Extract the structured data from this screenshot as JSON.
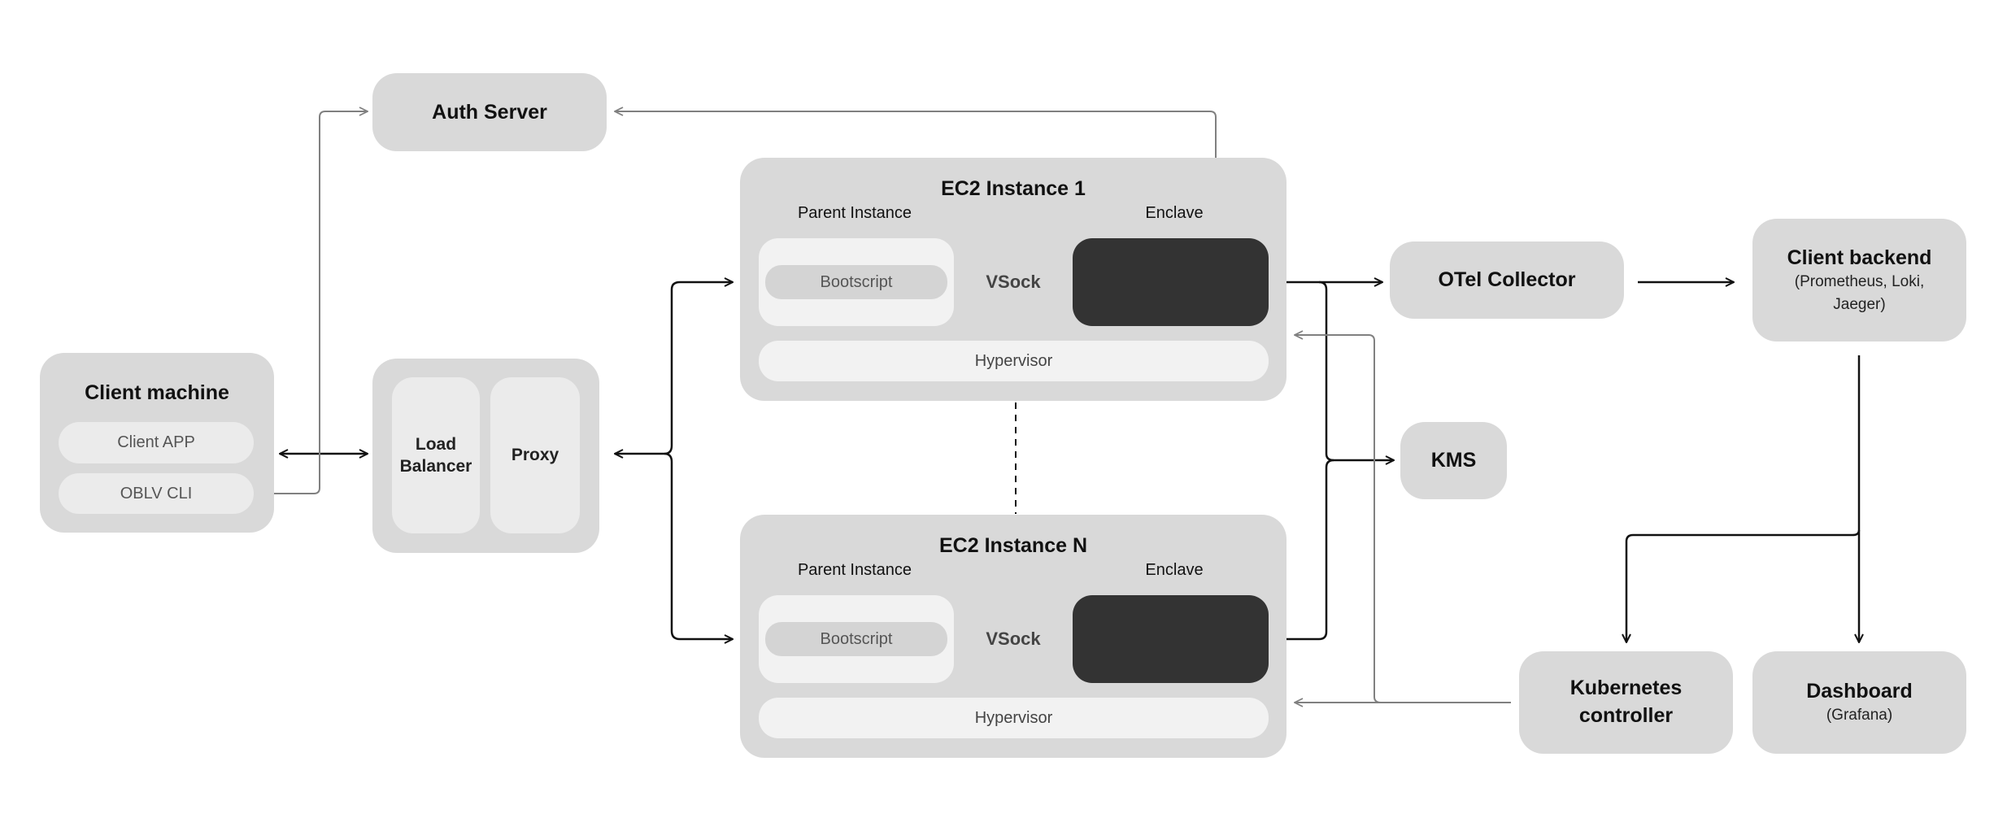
{
  "auth_server": {
    "title": "Auth Server"
  },
  "client_machine": {
    "title": "Client machine",
    "items": [
      "Client APP",
      "OBLV CLI"
    ]
  },
  "gateway": {
    "load_balancer": "Load Balancer",
    "proxy": "Proxy"
  },
  "ec2_instances": [
    {
      "title": "EC2 Instance 1",
      "parent_label": "Parent Instance",
      "enclave_label": "Enclave",
      "bootscript": "Bootscript",
      "vsock": "VSock",
      "hypervisor": "Hypervisor"
    },
    {
      "title": "EC2 Instance N",
      "parent_label": "Parent Instance",
      "enclave_label": "Enclave",
      "bootscript": "Bootscript",
      "vsock": "VSock",
      "hypervisor": "Hypervisor"
    }
  ],
  "otel_collector": {
    "title": "OTel Collector"
  },
  "client_backend": {
    "title": "Client backend",
    "subtitle": "(Prometheus, Loki, Jaeger)"
  },
  "kms": {
    "title": "KMS"
  },
  "kubernetes": {
    "title": "Kubernetes controller"
  },
  "dashboard": {
    "title": "Dashboard",
    "subtitle": "(Grafana)"
  },
  "colors": {
    "box": "#d9d9d9",
    "inner": "#ebebeb",
    "light": "#f2f2f2",
    "enclave": "#333333",
    "line_dark": "#111111",
    "line_gray": "#808080"
  }
}
